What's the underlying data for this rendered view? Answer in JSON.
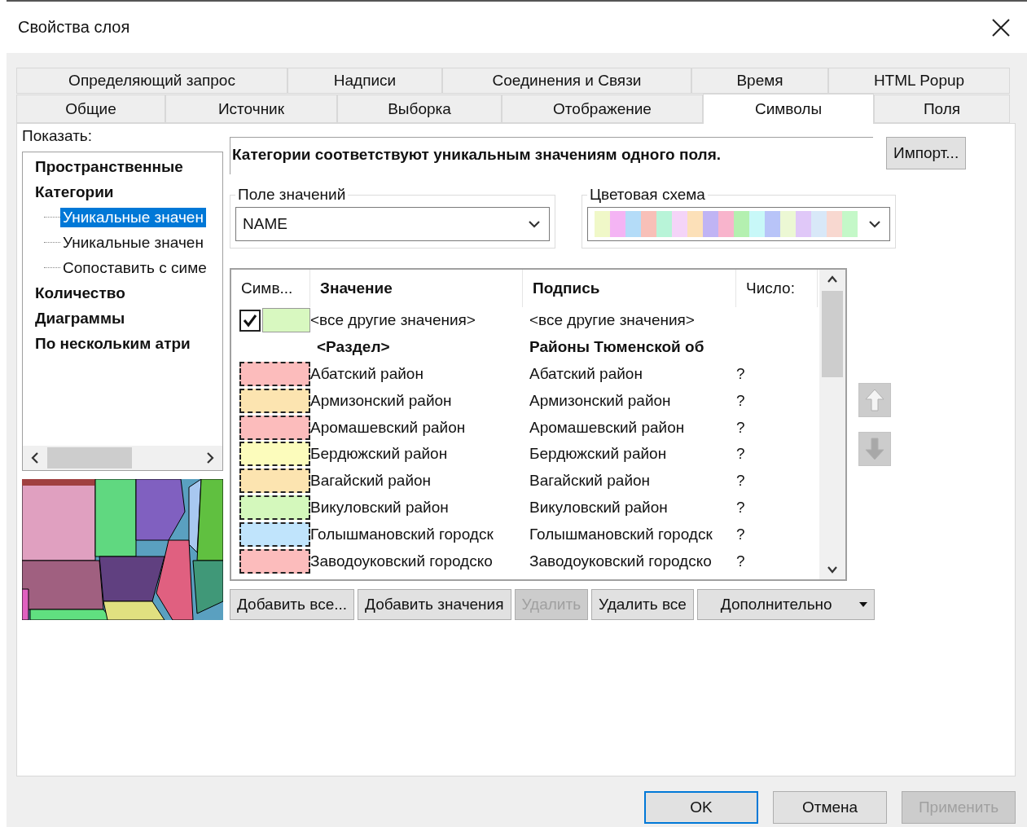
{
  "window": {
    "title": "Свойства слоя"
  },
  "tabs": [
    [
      {
        "label": "Определяющий запрос",
        "selected": false
      },
      {
        "label": "Надписи",
        "selected": false
      },
      {
        "label": "Соединения и Связи",
        "selected": false
      },
      {
        "label": "Время",
        "selected": false
      },
      {
        "label": "HTML Popup",
        "selected": false
      }
    ],
    [
      {
        "label": "Общие",
        "selected": false
      },
      {
        "label": "Источник",
        "selected": false
      },
      {
        "label": "Выборка",
        "selected": false
      },
      {
        "label": "Отображение",
        "selected": false
      },
      {
        "label": "Символы",
        "selected": true
      },
      {
        "label": "Поля",
        "selected": false
      }
    ]
  ],
  "show": {
    "label": "Показать:",
    "tree": [
      {
        "label": "Пространственные",
        "selected": false
      },
      {
        "label": "Категории",
        "selected": false,
        "children": [
          {
            "label": "Уникальные значен",
            "selected": true
          },
          {
            "label": "Уникальные значен",
            "selected": false
          },
          {
            "label": "Сопоставить с симе",
            "selected": false
          }
        ]
      },
      {
        "label": "Количество",
        "selected": false
      },
      {
        "label": "Диаграммы",
        "selected": false
      },
      {
        "label": "По нескольким атри",
        "selected": false
      }
    ]
  },
  "description": "Категории соответствуют уникальным значениям одного поля.",
  "import_button": "Импорт...",
  "value_field": {
    "label": "Поле значений",
    "value": "NAME"
  },
  "color_scheme": {
    "label": "Цветовая схема",
    "swatches": [
      {
        "color": "#f0f8c8"
      },
      {
        "color": "#f4b4f4"
      },
      {
        "color": "#b4dcf8"
      },
      {
        "color": "#f8c0b8"
      },
      {
        "color": "#b8f4d8"
      },
      {
        "color": "#f4d4f8"
      },
      {
        "color": "#fce0b8"
      },
      {
        "color": "#c0b4f4"
      },
      {
        "color": "#f8b4cc"
      },
      {
        "color": "#b4f0b0"
      },
      {
        "color": "#c8f8f8"
      },
      {
        "color": "#b8c4f8"
      },
      {
        "color": "#ecf8d4"
      },
      {
        "color": "#e0c8f8"
      },
      {
        "color": "#d8e8f8"
      },
      {
        "color": "#f8d8d0"
      },
      {
        "color": "#c4f8c8"
      }
    ]
  },
  "table": {
    "columns": [
      "Симв...",
      "Значение",
      "Подпись",
      "Число:"
    ],
    "rows": [
      {
        "kind": "other",
        "checked": true,
        "color": "#d8f8c0",
        "value": "<все другие значения>",
        "label": "<все другие значения>"
      },
      {
        "kind": "heading",
        "value": "<Раздел>",
        "label": "Районы Тюменской об"
      },
      {
        "kind": "value",
        "color": "#fcbcbc",
        "value": "Абатский район",
        "label": "Абатский район",
        "count": "?"
      },
      {
        "kind": "value",
        "color": "#fce4b0",
        "value": "Армизонский район",
        "label": "Армизонский район",
        "count": "?"
      },
      {
        "kind": "value",
        "color": "#fcbcbc",
        "value": "Аромашевский район",
        "label": "Аромашевский район",
        "count": "?"
      },
      {
        "kind": "value",
        "color": "#fcfcbc",
        "value": "Бердюжский район",
        "label": "Бердюжский район",
        "count": "?"
      },
      {
        "kind": "value",
        "color": "#fce4b0",
        "value": "Вагайский район",
        "label": "Вагайский район",
        "count": "?"
      },
      {
        "kind": "value",
        "color": "#d4f8bc",
        "value": "Викуловский район",
        "label": "Викуловский район",
        "count": "?"
      },
      {
        "kind": "value",
        "color": "#c0e4fc",
        "value": "Голышмановский городск",
        "label": "Голышмановский городск",
        "count": "?"
      },
      {
        "kind": "value",
        "color": "#fcbcbc",
        "value": "Заводоуковский городско",
        "label": "Заводоуковский городско",
        "count": "?"
      }
    ]
  },
  "actions": [
    {
      "label": "Добавить все...",
      "disabled": false
    },
    {
      "label": "Добавить значения",
      "disabled": false
    },
    {
      "label": "Удалить",
      "disabled": true
    },
    {
      "label": "Удалить все",
      "disabled": false
    },
    {
      "label": "Дополнительно",
      "disabled": false,
      "dropdown": true
    }
  ],
  "footer": [
    {
      "label": "OK",
      "default": true,
      "disabled": false
    },
    {
      "label": "Отмена",
      "default": false,
      "disabled": false
    },
    {
      "label": "Применить",
      "default": false,
      "disabled": true
    }
  ]
}
